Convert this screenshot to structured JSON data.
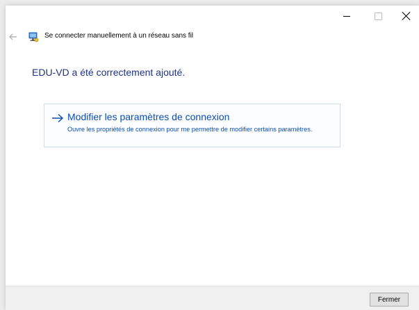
{
  "window": {
    "nav_title": "Se connecter manuellement à un réseau sans fil",
    "caption_buttons": [
      "minimize",
      "maximize",
      "close"
    ]
  },
  "main": {
    "heading": "EDU-VD a été correctement ajouté.",
    "option": {
      "title": "Modifier les paramètres de connexion",
      "description": "Ouvre les propriétés de connexion pour me permettre de modifier certains paramètres."
    }
  },
  "footer": {
    "close_label": "Fermer"
  },
  "colors": {
    "heading": "#1e3287",
    "link": "#0a4db3",
    "option_border": "#c7def3",
    "footer_bg": "#f0f0f0"
  },
  "icons": {
    "back": "back-arrow-icon",
    "network": "network-icon",
    "option": "right-arrow-icon"
  }
}
